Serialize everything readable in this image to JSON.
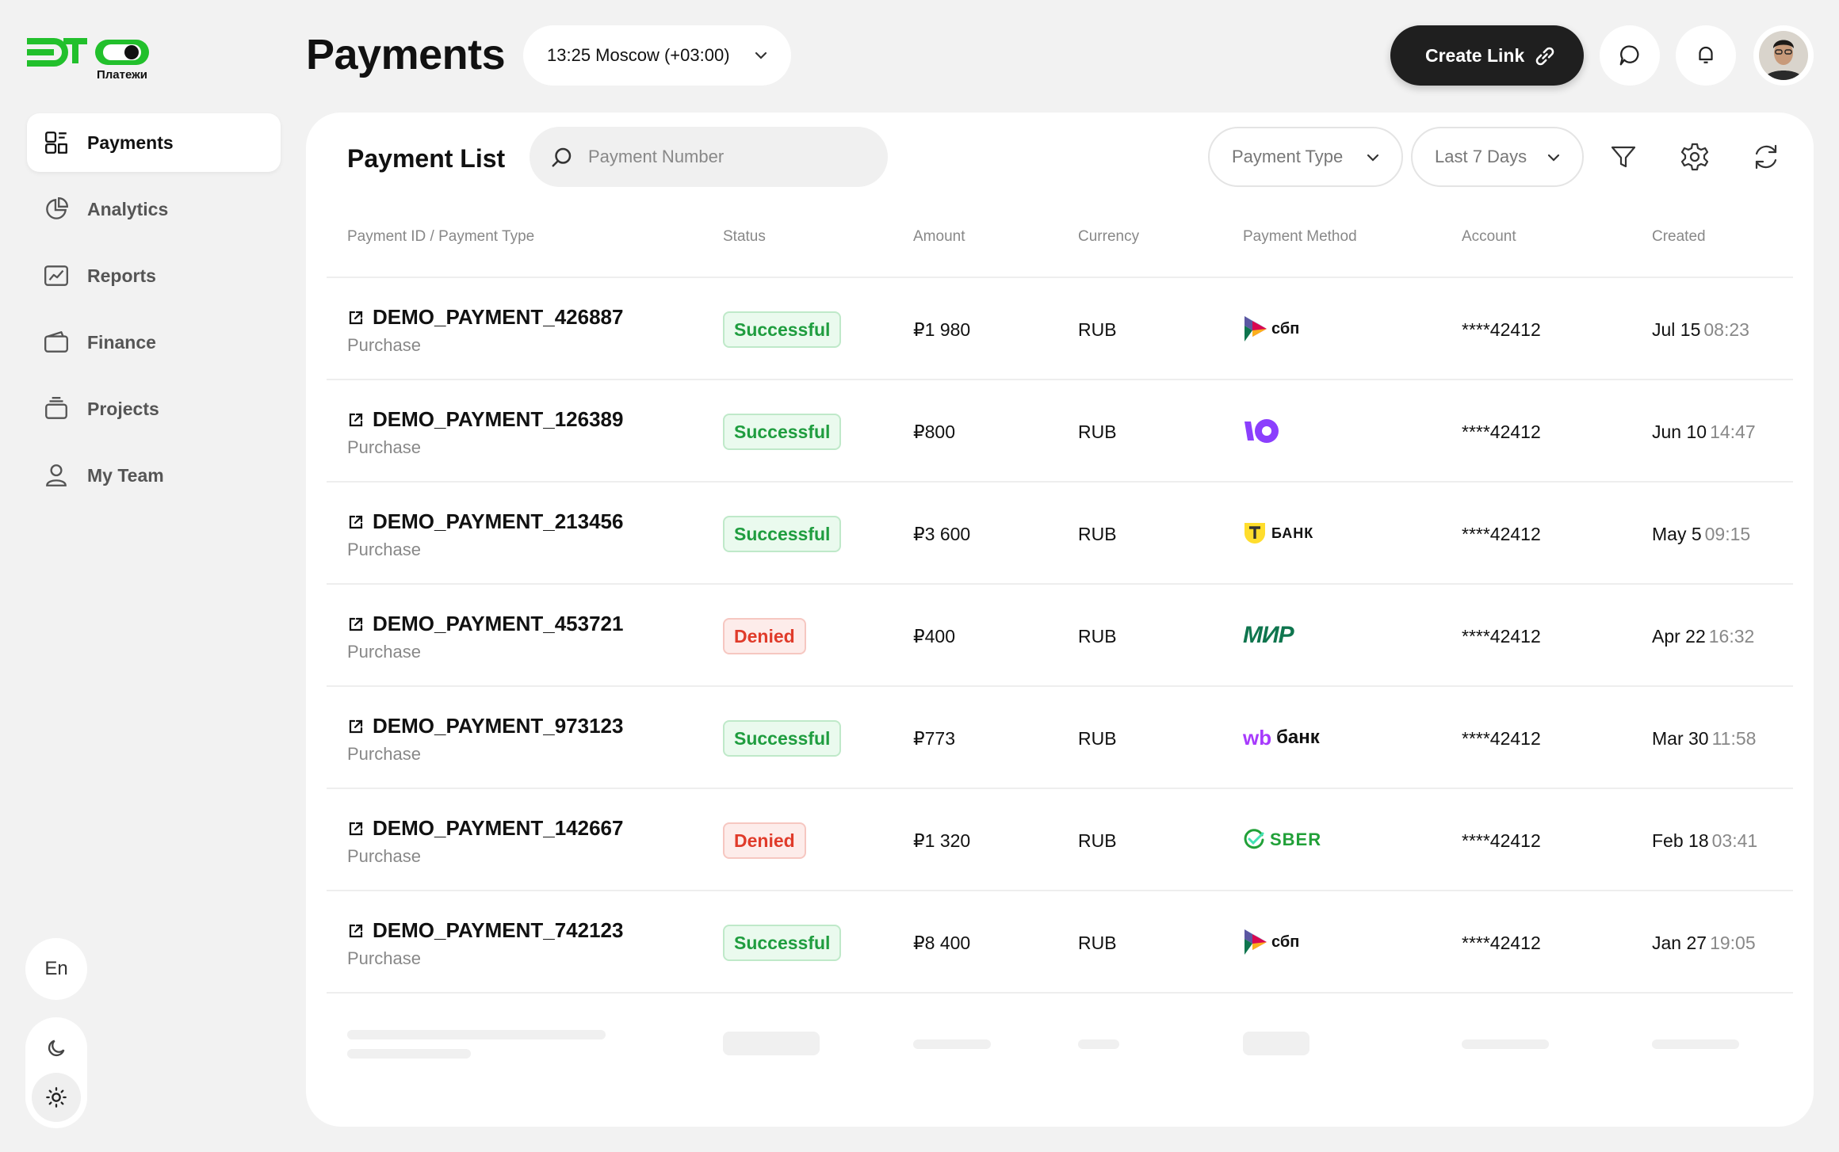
{
  "brand": {
    "logo_text": "ЭТО",
    "logo_sub": "Платежи",
    "accent": "#22c02c"
  },
  "sidebar": {
    "items": [
      {
        "label": "Payments",
        "icon": "payments-icon",
        "active": true
      },
      {
        "label": "Analytics",
        "icon": "analytics-icon",
        "active": false
      },
      {
        "label": "Reports",
        "icon": "reports-icon",
        "active": false
      },
      {
        "label": "Finance",
        "icon": "finance-icon",
        "active": false
      },
      {
        "label": "Projects",
        "icon": "projects-icon",
        "active": false
      },
      {
        "label": "My Team",
        "icon": "team-icon",
        "active": false
      }
    ],
    "language": "En"
  },
  "header": {
    "title": "Payments",
    "timezone": "13:25 Moscow (+03:00)",
    "create_link_label": "Create Link"
  },
  "card": {
    "title": "Payment List",
    "search_placeholder": "Payment Number",
    "filter_type_label": "Payment Type",
    "filter_period_label": "Last 7 Days"
  },
  "table": {
    "columns": [
      "Payment ID / Payment Type",
      "Status",
      "Amount",
      "Currency",
      "Payment Method",
      "Account",
      "Created"
    ],
    "rows": [
      {
        "id": "DEMO_PAYMENT_426887",
        "type": "Purchase",
        "status": "Successful",
        "status_kind": "ok",
        "amount": "₽1 980",
        "currency": "RUB",
        "method": "сбп",
        "account": "****42412",
        "date": "Jul 15",
        "time": "08:23"
      },
      {
        "id": "DEMO_PAYMENT_126389",
        "type": "Purchase",
        "status": "Successful",
        "status_kind": "ok",
        "amount": "₽800",
        "currency": "RUB",
        "method": "yoomoney",
        "account": "****42412",
        "date": "Jun 10",
        "time": "14:47"
      },
      {
        "id": "DEMO_PAYMENT_213456",
        "type": "Purchase",
        "status": "Successful",
        "status_kind": "ok",
        "amount": "₽3 600",
        "currency": "RUB",
        "method": "БАНК",
        "account": "****42412",
        "date": "May 5",
        "time": "09:15"
      },
      {
        "id": "DEMO_PAYMENT_453721",
        "type": "Purchase",
        "status": "Denied",
        "status_kind": "bad",
        "amount": "₽400",
        "currency": "RUB",
        "method": "МИР",
        "account": "****42412",
        "date": "Apr 22",
        "time": "16:32"
      },
      {
        "id": "DEMO_PAYMENT_973123",
        "type": "Purchase",
        "status": "Successful",
        "status_kind": "ok",
        "amount": "₽773",
        "currency": "RUB",
        "method": "банк",
        "account": "****42412",
        "date": "Mar 30",
        "time": "11:58"
      },
      {
        "id": "DEMO_PAYMENT_142667",
        "type": "Purchase",
        "status": "Denied",
        "status_kind": "bad",
        "amount": "₽1 320",
        "currency": "RUB",
        "method": "SBER",
        "account": "****42412",
        "date": "Feb 18",
        "time": "03:41"
      },
      {
        "id": "DEMO_PAYMENT_742123",
        "type": "Purchase",
        "status": "Successful",
        "status_kind": "ok",
        "amount": "₽8 400",
        "currency": "RUB",
        "method": "сбп",
        "account": "****42412",
        "date": "Jan 27",
        "time": "19:05"
      }
    ]
  }
}
